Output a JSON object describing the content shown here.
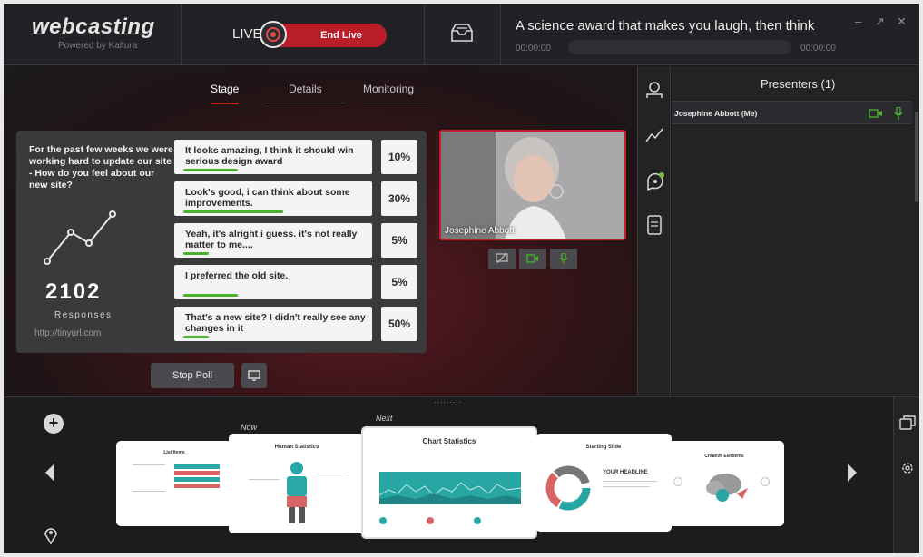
{
  "app": {
    "brand": "webcasting",
    "brand_sub": "Powered by Kaltura",
    "live_label": "LIVE",
    "end_live_label": "End Live",
    "event_title": "A science award that makes you laugh, then think",
    "time_elapsed": "00:00:00",
    "time_total": "00:00:00",
    "progress": 0
  },
  "tabs": [
    {
      "label": "Stage",
      "active": true
    },
    {
      "label": "Details",
      "active": false
    },
    {
      "label": "Monitoring",
      "active": false
    }
  ],
  "poll": {
    "question": "For the past few weeks we were working hard to update our site - How do you feel about our new site?",
    "responses_count": "2102",
    "responses_label": "Responses",
    "url": "http://tinyurl.com",
    "answers": [
      {
        "text": "It looks amazing, I think it should win serious design award",
        "percent": "10%",
        "bar": 0.3
      },
      {
        "text": "Look's good, i can think about some improvements.",
        "percent": "30%",
        "bar": 0.55
      },
      {
        "text": "Yeah, it's alright i guess. it's not really matter to me....",
        "percent": "5%",
        "bar": 0.14
      },
      {
        "text": "I preferred the old site.",
        "percent": "5%",
        "bar": 0.3
      },
      {
        "text": "That's a new site? I didn't really see any changes in it",
        "percent": "50%",
        "bar": 0.14
      }
    ],
    "stop_label": "Stop Poll"
  },
  "video": {
    "presenter_name": "Josephine Abbott"
  },
  "presenters": {
    "title": "Presenters (1)",
    "list": [
      {
        "name": "Josephine Abbott (Me)"
      }
    ]
  },
  "slides": {
    "now_label": "Now",
    "next_label": "Next",
    "items": [
      {
        "title": "List Items"
      },
      {
        "title": "Human Statistics"
      },
      {
        "title": "Chart Statistics"
      },
      {
        "title": "Starting Slide",
        "headline": "YOUR HEADLINE"
      },
      {
        "title": "Creative Elements"
      }
    ]
  },
  "colors": {
    "accent_red": "#c4202a",
    "accent_green": "#4caf2f"
  }
}
